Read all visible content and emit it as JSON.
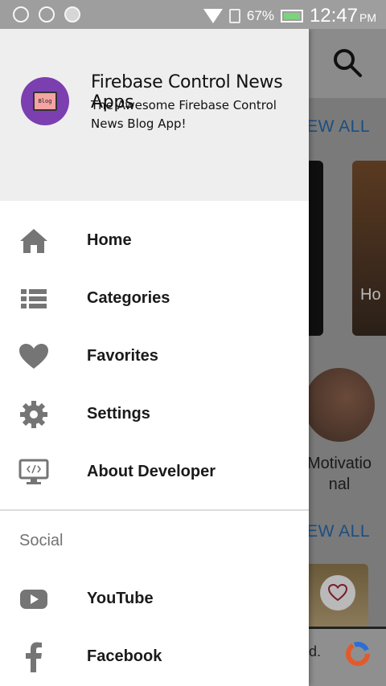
{
  "status_bar": {
    "battery": "67%",
    "time": "12:47",
    "ampm": "PM"
  },
  "background_app": {
    "view_all_1": "EW ALL",
    "view_all_2": "EW ALL",
    "card_text": "Ho",
    "category_label": "Motivatio\nnal",
    "bottom_text": "d."
  },
  "drawer": {
    "header": {
      "title": "Firebase Control News Apps",
      "subtitle": "The Awesome Firebase Control News Blog App!",
      "avatar_text": "Blog"
    },
    "menu_items": [
      {
        "label": "Home",
        "icon": "home-icon"
      },
      {
        "label": "Categories",
        "icon": "list-icon"
      },
      {
        "label": "Favorites",
        "icon": "heart-icon"
      },
      {
        "label": "Settings",
        "icon": "gear-icon"
      },
      {
        "label": "About Developer",
        "icon": "monitor-code-icon"
      }
    ],
    "section_title": "Social",
    "social_items": [
      {
        "label": "YouTube",
        "icon": "youtube-icon"
      },
      {
        "label": "Facebook",
        "icon": "facebook-icon"
      }
    ]
  },
  "colors": {
    "icon_gray": "#757575",
    "accent_purple": "#7b3fb0",
    "link_blue": "#1c4e80"
  }
}
